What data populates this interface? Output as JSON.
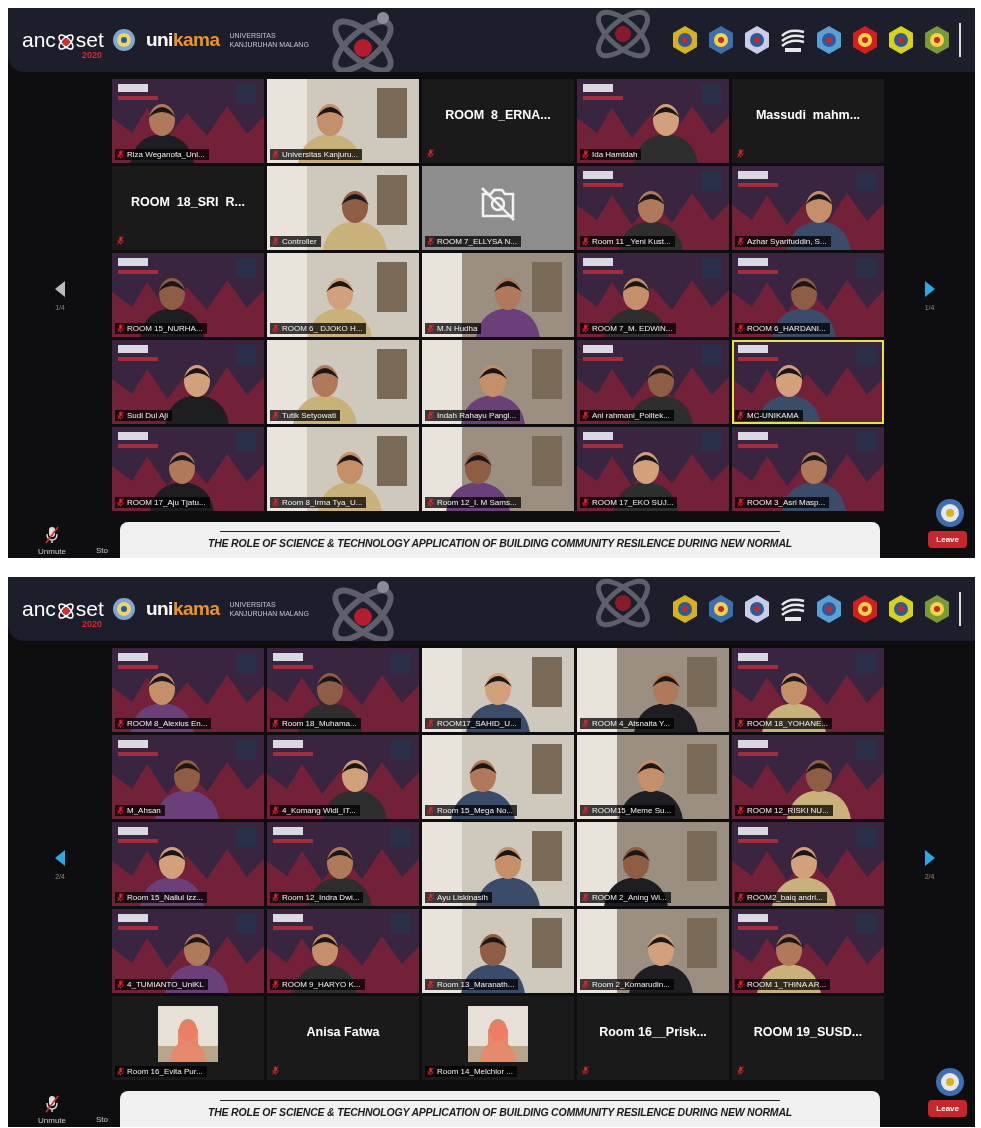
{
  "screens": [
    {
      "header": {
        "logo_left": "anc",
        "logo_right": "set",
        "logo_year": "2020",
        "brand_left": "uni",
        "brand_right": "kama",
        "university_line1": "UNIVERSITAS",
        "university_line2": "KANJURUHAN MALANG"
      },
      "page_left": "1/4",
      "page_right": "1/4",
      "tiles": [
        {
          "kind": "video",
          "label": "Riza Weganofa_Uni...",
          "active_speaker": false
        },
        {
          "kind": "video",
          "label": "Universitas Kanjuru...",
          "active_speaker": false
        },
        {
          "kind": "name",
          "label": "ROOM  8_ERNA...",
          "active_speaker": false
        },
        {
          "kind": "video",
          "label": "Ida Hamidah",
          "active_speaker": false
        },
        {
          "kind": "name",
          "label": "Massudi  mahm...",
          "active_speaker": false
        },
        {
          "kind": "name",
          "label": "ROOM  18_SRI  R...",
          "active_speaker": false
        },
        {
          "kind": "video",
          "label": "Controller",
          "active_speaker": false
        },
        {
          "kind": "camera-off",
          "label": "ROOM 7_ELLYSA N...",
          "active_speaker": false
        },
        {
          "kind": "video",
          "label": "Room 11 _Yeni Kust...",
          "active_speaker": false
        },
        {
          "kind": "video",
          "label": "Azhar Syarifuddin, S...",
          "active_speaker": false
        },
        {
          "kind": "video",
          "label": "ROOM 15_NURHA...",
          "active_speaker": false
        },
        {
          "kind": "video",
          "label": "ROOM 6_ DJOKO H...",
          "active_speaker": false
        },
        {
          "kind": "video",
          "label": "M.N Hudha",
          "active_speaker": false
        },
        {
          "kind": "video",
          "label": "ROOM 7_M. EDWIN...",
          "active_speaker": false
        },
        {
          "kind": "video",
          "label": "ROOM 6_HARDANI...",
          "active_speaker": false
        },
        {
          "kind": "video",
          "label": "Sudi Dul Aji",
          "active_speaker": false
        },
        {
          "kind": "video",
          "label": "Tutik Setyowati",
          "active_speaker": false
        },
        {
          "kind": "video",
          "label": "Indah Rahayu Pangl...",
          "active_speaker": false
        },
        {
          "kind": "video",
          "label": "Ani rahmani_Politek...",
          "active_speaker": false
        },
        {
          "kind": "video",
          "label": "MC-UNIKAMA",
          "active_speaker": true
        },
        {
          "kind": "video",
          "label": "ROOM 17_Aju Tjatu...",
          "active_speaker": false
        },
        {
          "kind": "video",
          "label": "Room 8_Irma Tya_U...",
          "active_speaker": false
        },
        {
          "kind": "video",
          "label": "Room 12_I. M Sams...",
          "active_speaker": false
        },
        {
          "kind": "video",
          "label": "ROOM 17_EKO SUJ...",
          "active_speaker": false
        },
        {
          "kind": "video",
          "label": "ROOM 3_Asri Masp...",
          "active_speaker": false
        }
      ],
      "footer": {
        "unmute": "Unmute",
        "stop": "Sto",
        "banner": "THE ROLE OF SCIENCE & TECHNOLOGY APPLICATION OF BUILDING COMMUNITY RESILENCE DURING NEW NORMAL",
        "leave": "Leave"
      }
    },
    {
      "header": {
        "logo_left": "anc",
        "logo_right": "set",
        "logo_year": "2020",
        "brand_left": "uni",
        "brand_right": "kama",
        "university_line1": "UNIVERSITAS",
        "university_line2": "KANJURUHAN MALANG"
      },
      "page_left": "2/4",
      "page_right": "2/4",
      "tiles": [
        {
          "kind": "video",
          "label": "ROOM 8_Alexius En...",
          "active_speaker": false
        },
        {
          "kind": "video",
          "label": "Room 18_Muhama...",
          "active_speaker": false
        },
        {
          "kind": "video",
          "label": "ROOM17_SAHID_U...",
          "active_speaker": false
        },
        {
          "kind": "video",
          "label": "ROOM 4_Atsnaita Y...",
          "active_speaker": false
        },
        {
          "kind": "video",
          "label": "ROOM 18_YOHANE...",
          "active_speaker": false
        },
        {
          "kind": "video",
          "label": "M_Ahsan",
          "active_speaker": false
        },
        {
          "kind": "video",
          "label": "4_Komang Widi_IT...",
          "active_speaker": false
        },
        {
          "kind": "video",
          "label": "Room 15_Mega No...",
          "active_speaker": false
        },
        {
          "kind": "video",
          "label": "ROOM15_Meme Su...",
          "active_speaker": false
        },
        {
          "kind": "video",
          "label": "ROOM 12_RISKI NU...",
          "active_speaker": false
        },
        {
          "kind": "video",
          "label": "Room 15_Nailul Izz...",
          "active_speaker": false
        },
        {
          "kind": "video",
          "label": "Room 12_Indra Dwi...",
          "active_speaker": false
        },
        {
          "kind": "video",
          "label": "Ayu Liskinasih",
          "active_speaker": false
        },
        {
          "kind": "video",
          "label": "ROOM 2_Aning Wi...",
          "active_speaker": false
        },
        {
          "kind": "video",
          "label": "ROOM2_baiq andri...",
          "active_speaker": false
        },
        {
          "kind": "video",
          "label": "4_TUMIANTO_UniKL",
          "active_speaker": false
        },
        {
          "kind": "video",
          "label": "ROOM 9_HARYO K...",
          "active_speaker": false
        },
        {
          "kind": "video",
          "label": "Room 13_Maranath...",
          "active_speaker": false
        },
        {
          "kind": "video",
          "label": "Room 2_Komarudin...",
          "active_speaker": false
        },
        {
          "kind": "video",
          "label": "ROOM 1_THINA AR...",
          "active_speaker": false
        },
        {
          "kind": "avatar",
          "label": "Room 16_Evita Pur...",
          "active_speaker": false
        },
        {
          "kind": "name",
          "label": "Anisa Fatwa",
          "active_speaker": false
        },
        {
          "kind": "avatar",
          "label": "Room 14_Melchior ...",
          "active_speaker": false
        },
        {
          "kind": "name",
          "label": "Room 16__Prisk...",
          "active_speaker": false
        },
        {
          "kind": "name",
          "label": "ROOM 19_SUSD...",
          "active_speaker": false
        }
      ],
      "footer": {
        "unmute": "Unmute",
        "stop": "Sto",
        "banner": "THE ROLE OF SCIENCE & TECHNOLOGY APPLICATION OF BUILDING COMMUNITY RESILENCE DURING NEW NORMAL",
        "leave": "Leave"
      }
    }
  ]
}
